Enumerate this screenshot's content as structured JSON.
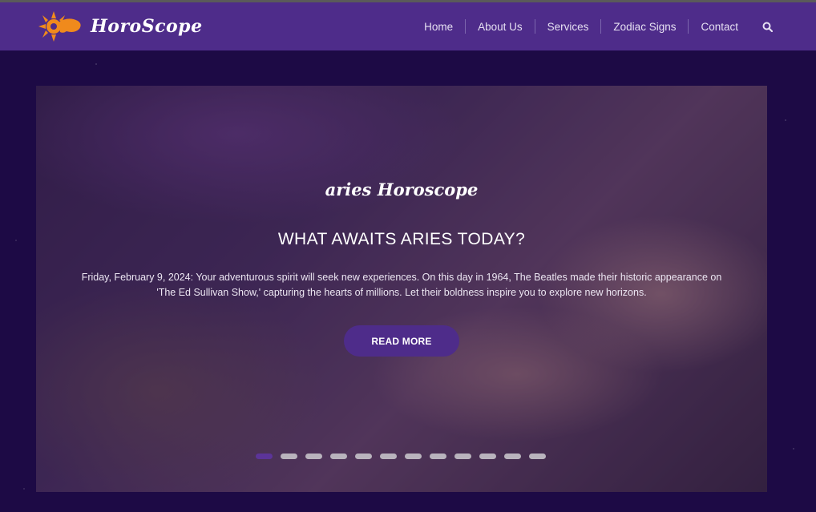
{
  "brand": {
    "logo_text": "HoroScope",
    "logo_icon": "sun-bull-icon"
  },
  "nav": {
    "items": [
      {
        "label": "Home"
      },
      {
        "label": "About Us"
      },
      {
        "label": "Services"
      },
      {
        "label": "Zodiac Signs"
      },
      {
        "label": "Contact"
      }
    ],
    "search_icon": "search-icon"
  },
  "hero": {
    "subtitle": "aries Horoscope",
    "title": "WHAT AWAITS ARIES TODAY?",
    "text": "Friday, February 9, 2024: Your adventurous spirit will seek new experiences. On this day in 1964, The Beatles made their historic appearance on 'The Ed Sullivan Show,' capturing the hearts of millions. Let their boldness inspire you to explore new horizons.",
    "button_label": "READ MORE",
    "slide_count": 12,
    "active_slide": 1
  },
  "colors": {
    "navbar": "#4e2c8a",
    "background": "#1d0a45",
    "accent": "#5c3499",
    "logo_orange": "#f08a1c"
  }
}
